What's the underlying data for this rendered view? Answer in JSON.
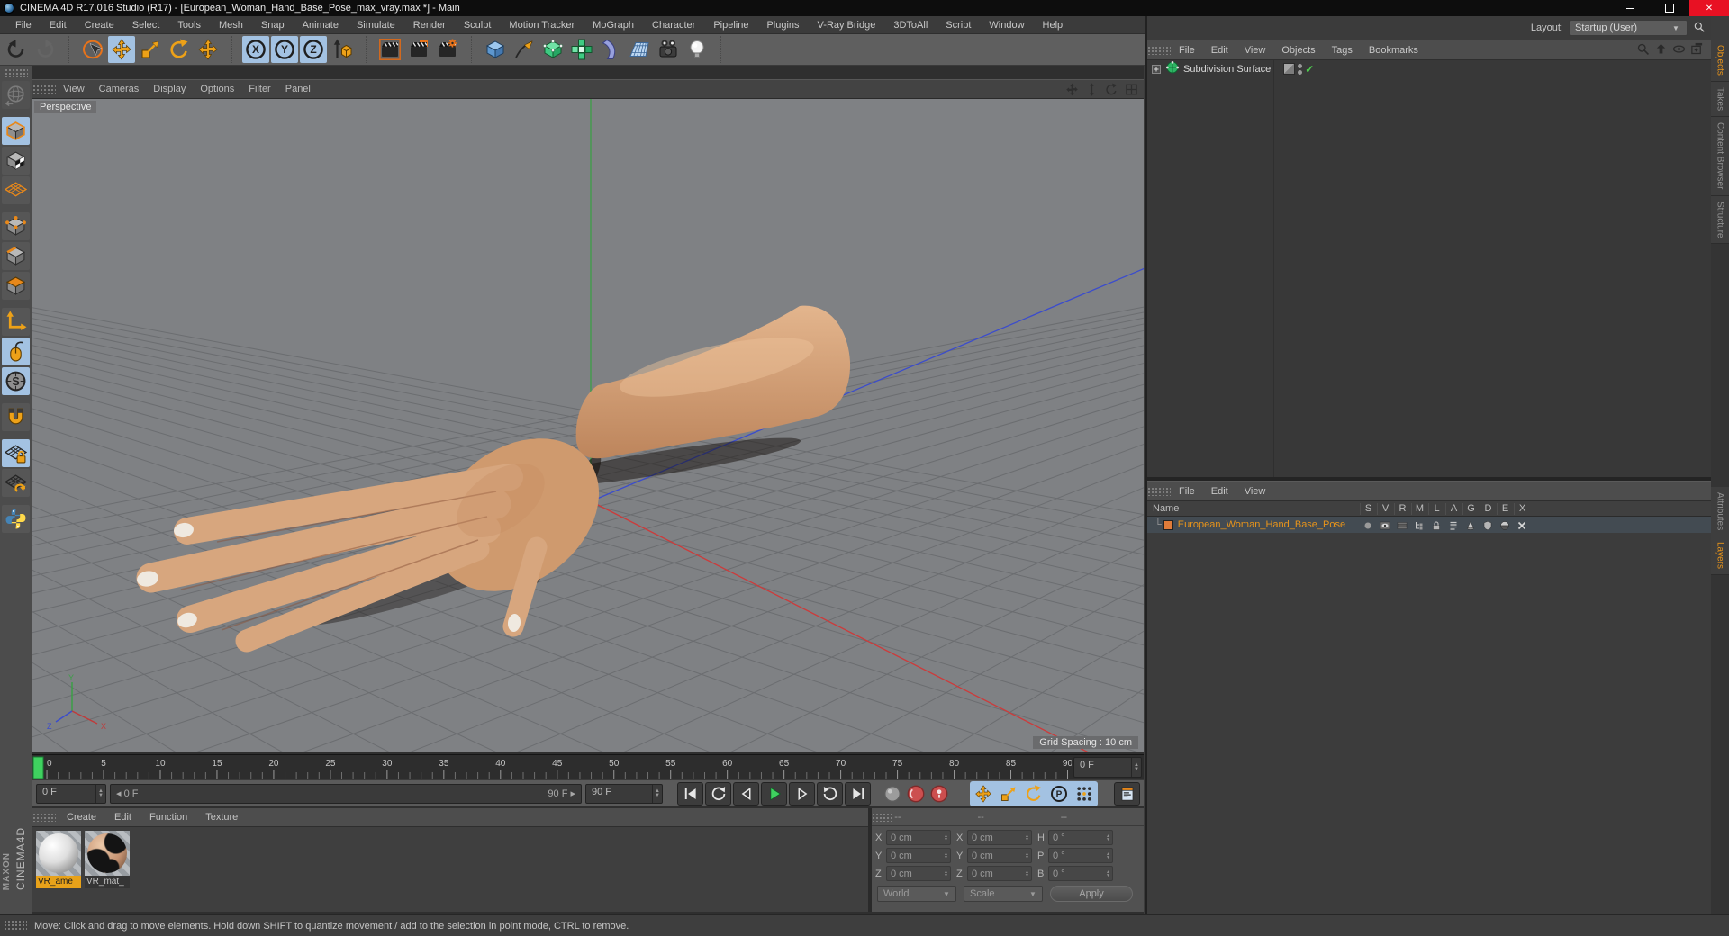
{
  "title_bar": {
    "title": "CINEMA 4D R17.016 Studio (R17) - [European_Woman_Hand_Base_Pose_max_vray.max *] - Main",
    "controls": {
      "minimize": "minimize",
      "maximize": "maximize",
      "close": "✕"
    }
  },
  "menu_bar": {
    "items": [
      "File",
      "Edit",
      "Create",
      "Select",
      "Tools",
      "Mesh",
      "Snap",
      "Animate",
      "Simulate",
      "Render",
      "Sculpt",
      "Motion Tracker",
      "MoGraph",
      "Character",
      "Pipeline",
      "Plugins",
      "V-Ray Bridge",
      "3DToAll",
      "Script",
      "Window",
      "Help"
    ]
  },
  "layout_selector": {
    "label": "Layout:",
    "value": "Startup (User)"
  },
  "toolbar": {
    "groups": [
      {
        "icons": [
          "undo",
          "redo"
        ]
      },
      {
        "icons": [
          "live-selection",
          "move",
          "scale",
          "rotate",
          "last-tool"
        ]
      },
      {
        "icons": [
          "lock-x",
          "lock-y",
          "lock-z",
          "coord-system"
        ]
      },
      {
        "icons": [
          "render-view",
          "render-picture-viewer",
          "render-settings"
        ]
      },
      {
        "icons": [
          "add-cube",
          "spline-pen",
          "subdivision-surface",
          "modifiers",
          "deformer",
          "environment",
          "camera",
          "light"
        ]
      }
    ],
    "active": [
      "move",
      "lock-x",
      "lock-y",
      "lock-z"
    ],
    "disabled": [
      "redo"
    ]
  },
  "left_toolbar": {
    "groups": [
      {
        "icons": [
          "make-editable"
        ]
      },
      {
        "icons": [
          "model-mode",
          "texture-mode",
          "workplane-mode"
        ]
      },
      {
        "icons": [
          "points-mode",
          "edges-mode",
          "polygons-mode"
        ]
      },
      {
        "icons": [
          "enable-axis",
          "tweak-mode",
          "viewport-solo"
        ]
      },
      {
        "icons": [
          "snap"
        ]
      },
      {
        "icons": [
          "lock-workplane",
          "workplane"
        ]
      },
      {
        "icons": [
          "python"
        ]
      }
    ],
    "active": [
      "model-mode",
      "tweak-mode",
      "viewport-solo",
      "lock-workplane"
    ],
    "disabled": [
      "make-editable"
    ]
  },
  "viewport": {
    "menu": [
      "View",
      "Cameras",
      "Display",
      "Options",
      "Filter",
      "Panel"
    ],
    "nav_icons": [
      "pan",
      "zoom",
      "rotate-view",
      "toggle-panels"
    ],
    "camera_label": "Perspective",
    "grid_spacing_label": "Grid Spacing : 10 cm",
    "axis_gizmo": {
      "x": "X",
      "y": "Y",
      "z": "Z"
    }
  },
  "timeline": {
    "tick_labels": [
      "0",
      "5",
      "10",
      "15",
      "20",
      "25",
      "30",
      "35",
      "40",
      "45",
      "50",
      "55",
      "60",
      "65",
      "70",
      "75",
      "80",
      "85",
      "90"
    ],
    "total_frames": 90,
    "current_frame_spinner": "0 F"
  },
  "transport": {
    "frame_spinner": "0 F",
    "range_start": "0 F",
    "range_end": "90 F",
    "end_spinner": "90 F",
    "buttons": [
      "goto-start",
      "previous-key",
      "previous-frame",
      "play",
      "next-frame",
      "next-key",
      "goto-end"
    ],
    "record_buttons": [
      "record-objects",
      "autokeying",
      "keyframe-selection"
    ],
    "key_toggles": [
      "key-position",
      "key-scale",
      "key-rotation",
      "key-parameter",
      "key-pla"
    ],
    "timeline_button": "timeline-window"
  },
  "material_manager": {
    "menu": [
      "Create",
      "Edit",
      "Function",
      "Texture"
    ],
    "materials": [
      {
        "name": "VR_ame",
        "selected": true,
        "preview": "white-sphere"
      },
      {
        "name": "VR_mat_",
        "selected": false,
        "preview": "skin-sphere"
      }
    ]
  },
  "coordinate_manager": {
    "headers": [
      "--",
      "--",
      "--"
    ],
    "position": [
      {
        "label": "X",
        "value": "0 cm"
      },
      {
        "label": "Y",
        "value": "0 cm"
      },
      {
        "label": "Z",
        "value": "0 cm"
      }
    ],
    "size": [
      {
        "label": "X",
        "value": "0 cm"
      },
      {
        "label": "Y",
        "value": "0 cm"
      },
      {
        "label": "Z",
        "value": "0 cm"
      }
    ],
    "rotation": [
      {
        "label": "H",
        "value": "0 °"
      },
      {
        "label": "P",
        "value": "0 °"
      },
      {
        "label": "B",
        "value": "0 °"
      }
    ],
    "mode": "World",
    "scale_mode": "Scale",
    "apply_label": "Apply"
  },
  "object_manager": {
    "menu": [
      "File",
      "Edit",
      "View",
      "Objects",
      "Tags",
      "Bookmarks"
    ],
    "corner_icons": [
      "search",
      "up-level",
      "filter",
      "add-panel"
    ],
    "objects": [
      {
        "name": "Subdivision Surface",
        "enabled": true
      }
    ]
  },
  "layer_manager": {
    "menu": [
      "File",
      "Edit",
      "View"
    ],
    "name_header": "Name",
    "columns": [
      "S",
      "V",
      "R",
      "M",
      "L",
      "A",
      "G",
      "D",
      "E",
      "X"
    ],
    "row_icons": [
      "dot",
      "eye-box",
      "film",
      "hierarchy",
      "lock",
      "list",
      "light-cone",
      "shield",
      "mask",
      "xmark"
    ],
    "layers": [
      {
        "name": "European_Woman_Hand_Base_Pose",
        "color": "#e07b39"
      }
    ]
  },
  "side_tabs": {
    "top": [
      {
        "label": "Objects",
        "active": true
      },
      {
        "label": "Takes",
        "active": false
      },
      {
        "label": "Content Browser",
        "active": false
      },
      {
        "label": "Structure",
        "active": false
      }
    ],
    "bottom": [
      {
        "label": "Attributes",
        "active": false
      },
      {
        "label": "Layers",
        "active": true
      }
    ]
  },
  "status_bar": {
    "text": "Move: Click and drag to move elements. Hold down SHIFT to quantize movement / add to the selection in point mode, CTRL to remove."
  },
  "branding": {
    "line1": "MAXON",
    "line2": "CINEMA4D"
  },
  "colors": {
    "accent_orange": "#e8941a",
    "active_blue": "#a3c2e2",
    "play_green": "#3fd15f",
    "record_red": "#cc4f4f",
    "axis_x": "#c03a3a",
    "axis_y": "#3c9e46",
    "axis_z": "#3b4ccc"
  }
}
